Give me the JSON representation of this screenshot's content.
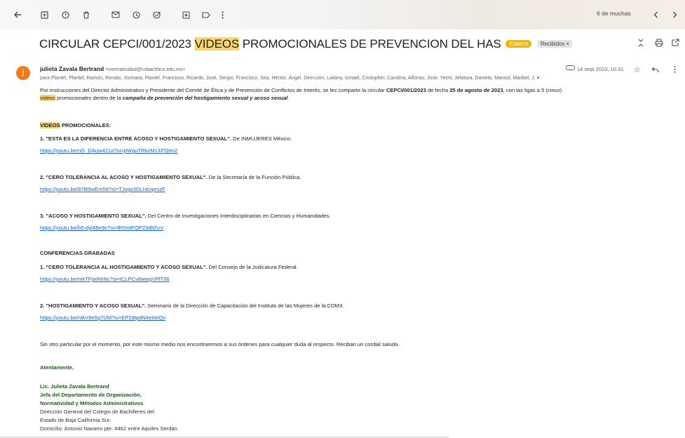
{
  "toolbar": {
    "pager": "6 de muchas"
  },
  "subject": {
    "before": "CIRCULAR CEPCI/001/2023 ",
    "highlight": "VIDEOS",
    "after": " PROMOCIONALES DE PREVENCION DEL HAS",
    "external_label": "Externo",
    "inbox_label": "Recibidos ×"
  },
  "message": {
    "avatar_letter": "j",
    "sender_name": "julieta Zavala Bertrand",
    "sender_email": "<normatividad@cobachbcs.edu.mx>",
    "recipients": "para Plantel, Plantel, Ramón, Renato, Xiomara, Plantel, Francisco, Ricardo, José, Sergio, Francisco, Sea, Héctor, Ángel, Dirección, Lailany, Ismael, Cristopher, Carolina, Alfonso, Jose, Yeimi, Jefatura, Daniela, Marisol, Maribel, J.",
    "date": "14 sept 2023, 10:31"
  },
  "body": {
    "intro_1": "Por instrucciones del Director Administrativo y Presidente del Comité de Ética y de Prevención de Conflictos de Interés, se les comparte la circular ",
    "intro_circular": "CEPCI/001/2023",
    "intro_2": " de fecha ",
    "intro_date": "25 de agosto de 2023",
    "intro_3": ", con las ligas a 5 (cinco)",
    "intro_videos": "videos",
    "intro_4": " promocionales dentro de la ",
    "intro_campaign": "campaña de prevención del hostigamiento sexual y acoso sexual",
    "intro_5": ".",
    "section1_highlight": "VIDEOS",
    "section1_rest": " PROMOCIONALES:",
    "items": [
      {
        "title": "1. \"ESTA ES LA DIFERENCIA ENTRE ACOSO Y HOSTIGAMIENTO SEXUAL\".",
        "source": " De INMUJERES México.",
        "url": "https://youtu.be/nG_DAuw421o?si=pWguTRkzM1XFOtm2"
      },
      {
        "title": "2. \"CERO TOLERANCIA AL ACOSO Y HOSTIGAMIENTO SEXUAL\".",
        "source": " De la Secretaría de la Función Pública.",
        "url": "https://youtu.be/87l69xiEm58?si=TJvgo3DLHzxprszF"
      },
      {
        "title": "3. \"ACOSO Y HOSTIGAMIENTO SEXUAL\".",
        "source": " Del Centro de Investigaciones Interdisciplinarias en Ciencias y Humanidades.",
        "url": "https://youtu.be/b5-dyl4Be9c?si=fR5mlFQP23dlIZoV"
      }
    ],
    "section2_title": "CONFERENCIAS GRABADAS",
    "conferences": [
      {
        "title": "1. \"CERO TOLERANCIA AL HOSTIGAMIENTO Y ACOSO SEXUAL\".",
        "source": " Del Consejo de la Judicatura Federal.",
        "url": "https://youtu.be/mkTFjixReNc?si=tCLPCv8wwgVPfT06"
      },
      {
        "title": "2. \"HOSTIGAMIENTO Y ACOSO SEXUAL\".",
        "source": " Seminario de la Dirección de Capacitación del Instituto de las Mujeres de la CDMX.",
        "url": "https://youtu.be/nIkV8e5g7UM?si=EP2dtpdN4eitIeQv"
      }
    ],
    "closing": "Sin otro particular por el momento, por este mismo medio nos encontraremos a sus órdenes para cualquier duda al respecto. Reciban un cordial saludo.",
    "signoff": "Atentamente,",
    "signature": {
      "name": "Lic. Julieta Zavala Bertrand",
      "role1": "Jefa del Departamento de Organización,",
      "role2": "Normatividad y Métodos Administrativos",
      "org1": "Dirección General del Colegio de Bachilleres del",
      "org2": "Estado de Baja California Sur.",
      "address": "Domicilio: Antonio Navarro pte. #462 entre Aquiles Serdán"
    }
  },
  "colors": {
    "highlight": "#fbd56b",
    "link": "#1a5fd0",
    "avatar": "#f07b1c",
    "external_chip": "#f5b400",
    "signature": "#1d5b1a"
  }
}
